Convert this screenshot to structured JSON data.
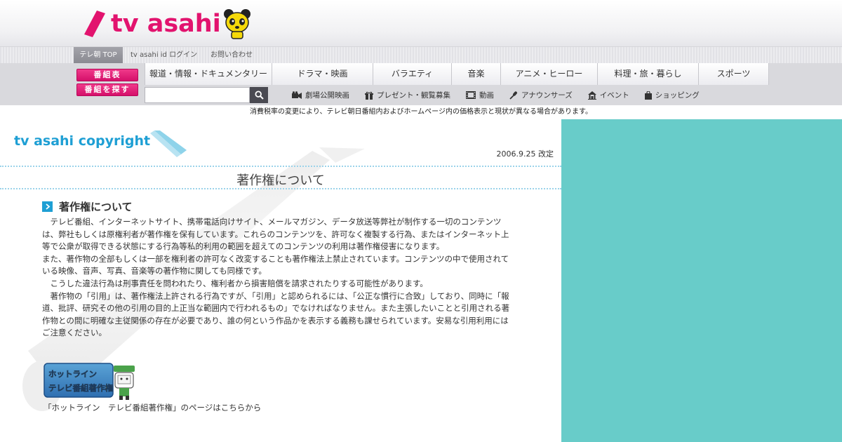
{
  "header": {
    "logo_text": "tv asahi"
  },
  "subnav": {
    "top_label": "テレ朝 TOP",
    "links": [
      "tv asahi id ログイン",
      "お問い合わせ"
    ]
  },
  "nav": {
    "buttons": [
      "番組表",
      "番組を探す"
    ],
    "categories": [
      "報道・情報・ドキュメンタリー",
      "ドラマ・映画",
      "バラエティ",
      "音楽",
      "アニメ・ヒーロー",
      "料理・旅・暮らし",
      "スポーツ"
    ],
    "search_placeholder": "",
    "subcategories": [
      {
        "label": "劇場公開映画",
        "icon": "camera-icon"
      },
      {
        "label": "プレゼント・観覧募集",
        "icon": "gift-icon"
      },
      {
        "label": "動画",
        "icon": "film-icon"
      },
      {
        "label": "アナウンサーズ",
        "icon": "microphone-icon"
      },
      {
        "label": "イベント",
        "icon": "event-icon"
      },
      {
        "label": "ショッピング",
        "icon": "shopping-bag-icon"
      }
    ]
  },
  "notice": "消費税率の変更により、テレビ朝日番組内およびホームページ内の価格表示と現状が異なる場合があります。",
  "main": {
    "section_title": "tv asahi copyright",
    "revision_date": "2006.9.25 改定",
    "heading": "著作権について",
    "sub_heading": "著作権について",
    "paragraphs": [
      "テレビ番組、インターネットサイト、携帯電話向けサイト、メールマガジン、データ放送等弊社が制作する一切のコンテンツは、弊社もしくは原権利者が著作権を保有しています。これらのコンテンツを、許可なく複製する行為、またはインターネット上等で公衆が取得できる状態にする行為等私的利用の範囲を超えてのコンテンツの利用は著作権侵害になります。",
      "また、著作物の全部もしくは一部を権利者の許可なく改変することも著作権法上禁止されています。コンテンツの中で使用されている映像、音声、写真、音楽等の著作物に関しても同様です。",
      "こうした違法行為は刑事責任を問われたり、権利者から損害賠償を請求されたりする可能性があります。",
      "著作物の「引用」は、著作権法上許される行為ですが、「引用」と認められるには、「公正な慣行に合致」しており、同時に「報道、批評、研究その他の引用の目的上正当な範囲内で行われるもの」でなければなりません。また主張したいことと引用される著作物との間に明確な主従関係の存在が必要であり、誰の何という作品かを表示する義務も課せられています。安易な引用利用にはご注意ください。"
    ],
    "hotline_banner_lines": [
      "ホットライン",
      "テレビ番組著作権"
    ],
    "hotline_caption": "「ホットライン　テレビ番組著作権」のページはこちらから"
  },
  "colors": {
    "brand_pink": "#e2136e",
    "accent_blue": "#1e9fd4",
    "sidebar_teal": "#68ccc9"
  }
}
